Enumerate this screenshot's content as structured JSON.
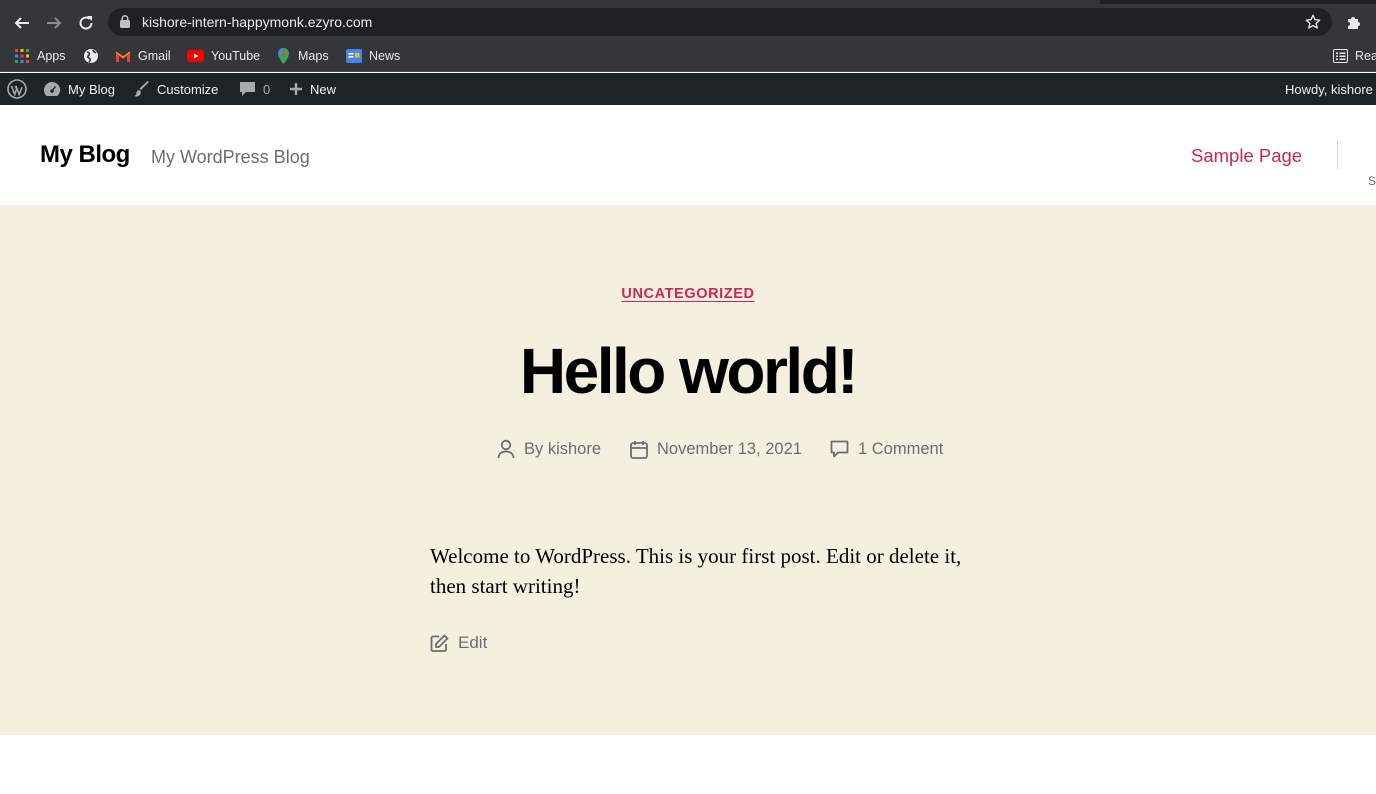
{
  "browser": {
    "url": "kishore-intern-happymonk.ezyro.com",
    "bookmarks": [
      {
        "label": "Apps",
        "icon": "apps-grid-icon"
      },
      {
        "label": "",
        "icon": "globe-icon"
      },
      {
        "label": "Gmail",
        "icon": "gmail-icon"
      },
      {
        "label": "YouTube",
        "icon": "youtube-icon"
      },
      {
        "label": "Maps",
        "icon": "maps-icon"
      },
      {
        "label": "News",
        "icon": "news-icon"
      }
    ],
    "reading_list_label": "Rea"
  },
  "admin_bar": {
    "site_name": "My Blog",
    "customize": "Customize",
    "comments_count": "0",
    "new_label": "New",
    "howdy": "Howdy, kishore"
  },
  "site": {
    "title": "My Blog",
    "description": "My WordPress Blog",
    "menu": [
      "Sample Page"
    ],
    "search_label": "S"
  },
  "post": {
    "category": "UNCATEGORIZED",
    "title": "Hello world!",
    "author": "By kishore",
    "date": "November 13, 2021",
    "comments": "1 Comment",
    "content": "Welcome to WordPress. This is your first post. Edit or delete it, then start writing!",
    "edit_label": "Edit"
  },
  "colors": {
    "accent": "#cd2653",
    "hero_background": "#f5efe0",
    "admin_bar": "#1d2327",
    "browser_chrome": "#35363a"
  }
}
